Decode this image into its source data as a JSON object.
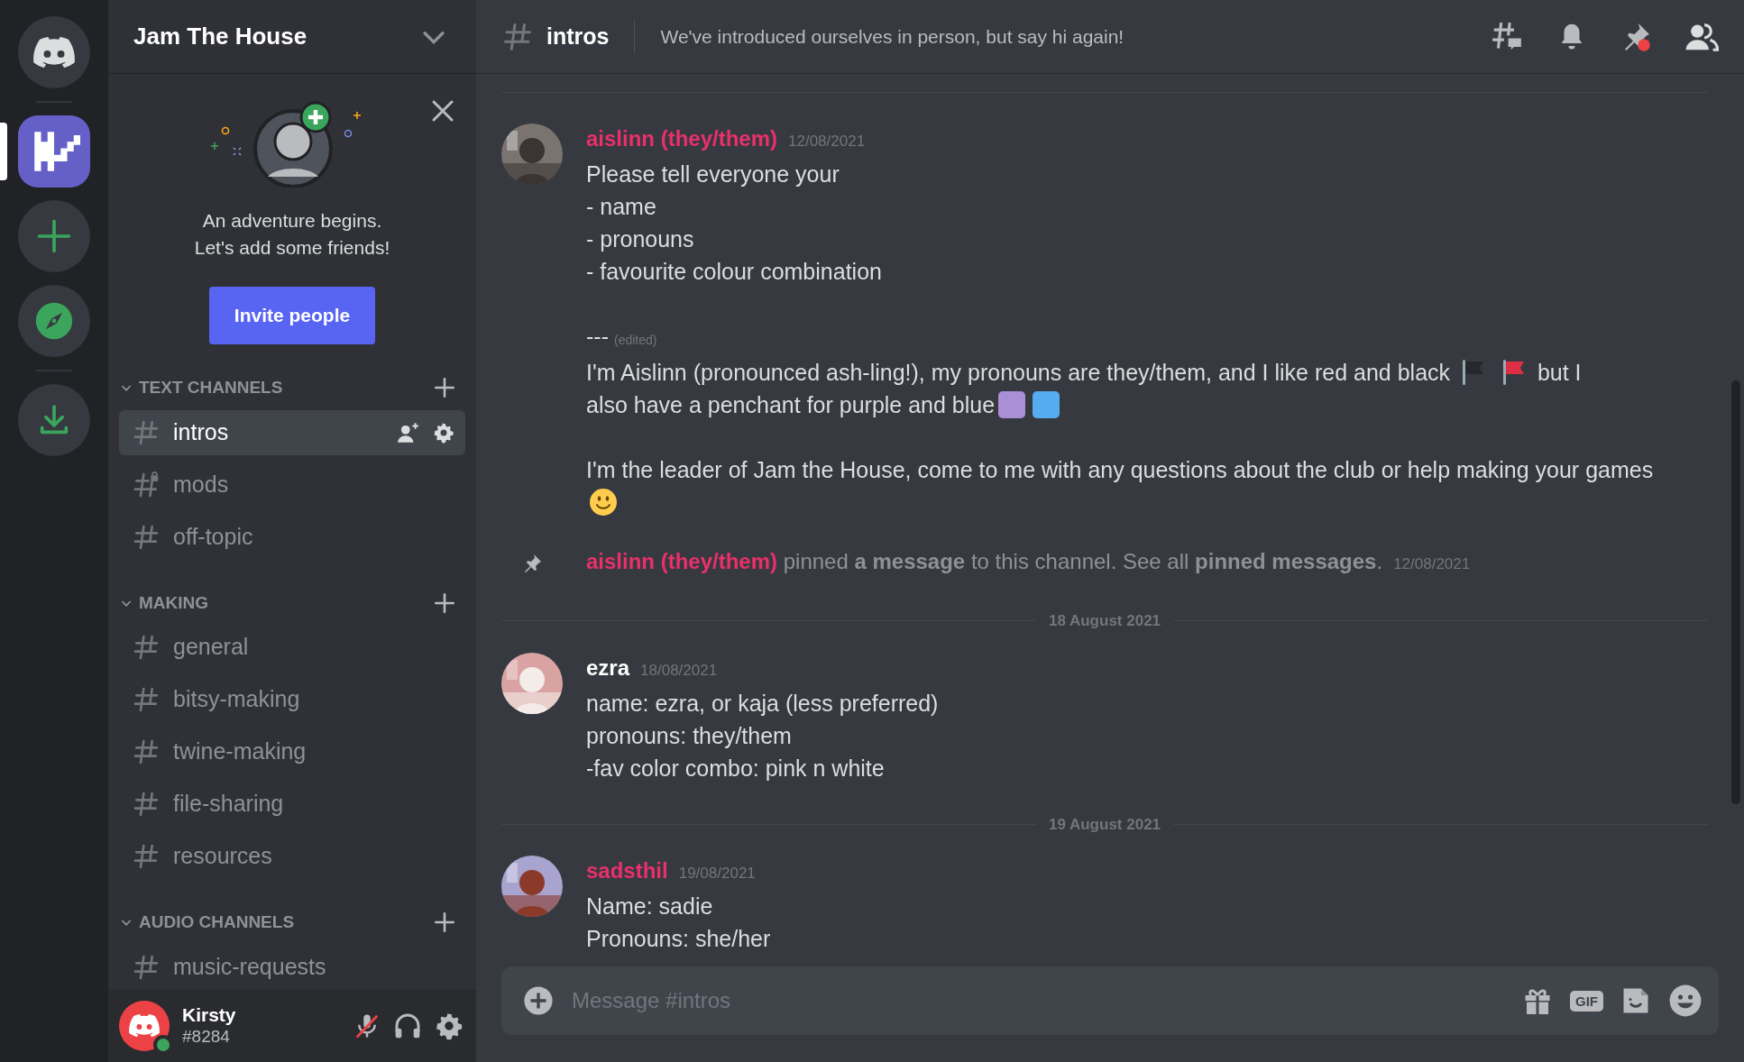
{
  "servers": [
    {
      "kind": "home",
      "selected": false
    },
    {
      "kind": "server",
      "selected": true
    },
    {
      "kind": "add",
      "selected": false
    },
    {
      "kind": "explore",
      "selected": false
    },
    {
      "kind": "download",
      "selected": false
    }
  ],
  "server_name": "Jam The House",
  "invite_card": {
    "text": "An adventure begins.\nLet's add some friends!",
    "button": "Invite people"
  },
  "categories": [
    {
      "name": "TEXT CHANNELS",
      "channels": [
        {
          "name": "intros",
          "selected": true,
          "locked": false
        },
        {
          "name": "mods",
          "selected": false,
          "locked": true
        },
        {
          "name": "off-topic",
          "selected": false,
          "locked": false
        }
      ]
    },
    {
      "name": "MAKING",
      "channels": [
        {
          "name": "general",
          "selected": false,
          "locked": false
        },
        {
          "name": "bitsy-making",
          "selected": false,
          "locked": false
        },
        {
          "name": "twine-making",
          "selected": false,
          "locked": false
        },
        {
          "name": "file-sharing",
          "selected": false,
          "locked": false
        },
        {
          "name": "resources",
          "selected": false,
          "locked": false
        }
      ]
    },
    {
      "name": "AUDIO CHANNELS",
      "channels": [
        {
          "name": "music-requests",
          "selected": false,
          "locked": false
        }
      ]
    }
  ],
  "user": {
    "name": "Kirsty",
    "tag": "#8284",
    "muted": true
  },
  "header": {
    "channel": "intros",
    "topic": "We've introduced ourselves in person, but say hi again!"
  },
  "messages": [
    {
      "kind": "message",
      "author": "aislinn (they/them)",
      "color": "#e9306a",
      "time": "12/08/2021",
      "blocks": [
        [
          {
            "kind": "text",
            "text": "Please tell everyone your\n- name\n- pronouns\n- favourite colour combination"
          }
        ],
        [
          {
            "kind": "text",
            "text": "---"
          },
          {
            "kind": "edited",
            "text": "(edited)"
          },
          {
            "kind": "break"
          },
          {
            "kind": "text",
            "text": "I'm Aislinn (pronounced ash-ling!), my pronouns are they/them, and I like red and black"
          },
          {
            "kind": "flag",
            "color": "#26282c"
          },
          {
            "kind": "flag",
            "color": "#dd2e44"
          },
          {
            "kind": "text",
            "text": "but I"
          },
          {
            "kind": "break"
          },
          {
            "kind": "text",
            "text": "also have a penchant for purple and blue"
          },
          {
            "kind": "square",
            "color": "#aa8ed6"
          },
          {
            "kind": "square",
            "color": "#55acee"
          }
        ],
        [
          {
            "kind": "text",
            "text": "I'm the leader of Jam the House, come to me with any questions about the club or help making your games"
          },
          {
            "kind": "smiley"
          }
        ]
      ]
    },
    {
      "kind": "pin",
      "author": "aislinn (they/them)",
      "color": "#e9306a",
      "text": "pinned **a message** to this channel. See all **pinned messages**.",
      "time": "12/08/2021"
    },
    {
      "kind": "divider",
      "label": "18 August 2021"
    },
    {
      "kind": "message",
      "author": "ezra",
      "color": "#ffffff",
      "time": "18/08/2021",
      "blocks": [
        [
          {
            "kind": "text",
            "text": "name: ezra, or kaja (less preferred)\npronouns: they/them\n-fav color combo: pink n white"
          }
        ]
      ]
    },
    {
      "kind": "divider",
      "label": "19 August 2021"
    },
    {
      "kind": "message",
      "author": "sadsthil",
      "color": "#e9306a",
      "time": "19/08/2021",
      "blocks": [
        [
          {
            "kind": "text",
            "text": "Name: sadie\nPronouns: she/her"
          }
        ]
      ]
    }
  ],
  "composer": {
    "placeholder": "Message #intros",
    "gif_label": "GIF"
  }
}
